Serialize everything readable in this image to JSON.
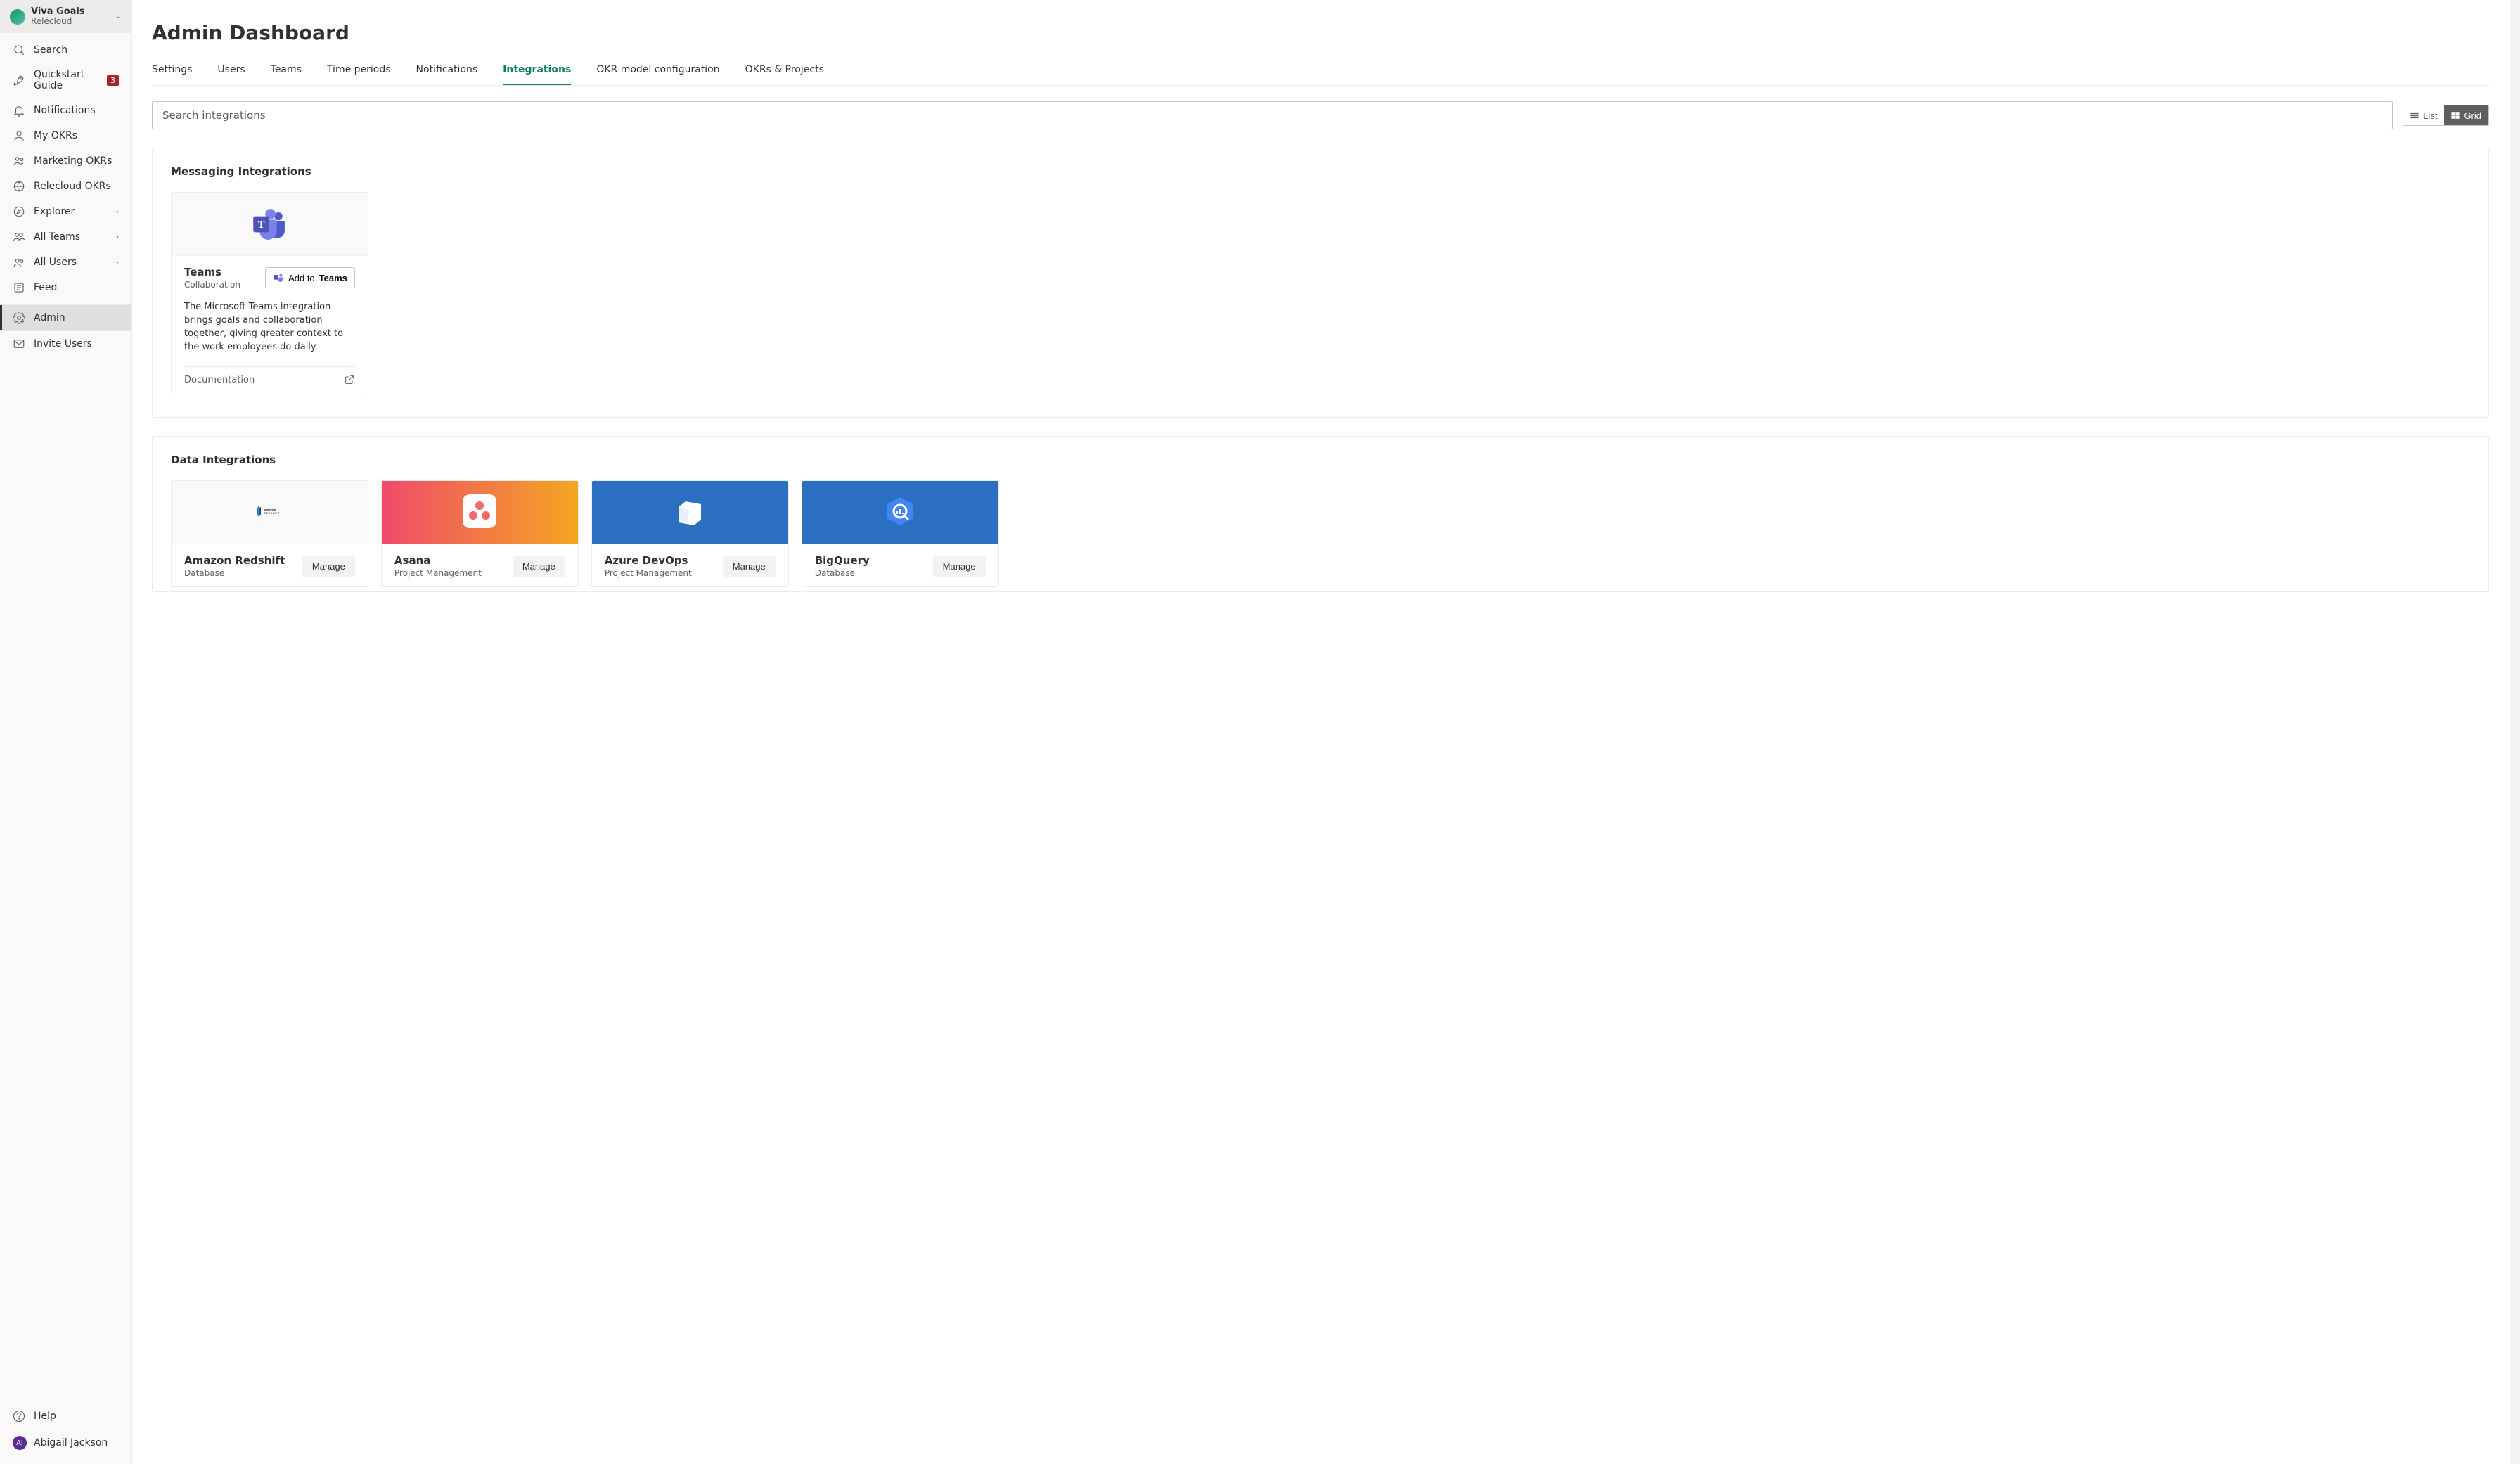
{
  "org": {
    "name": "Viva Goals",
    "sub": "Relecloud"
  },
  "sidebar": {
    "items": [
      {
        "label": "Search",
        "icon": "search",
        "badge": null,
        "expand": false
      },
      {
        "label": "Quickstart Guide",
        "icon": "rocket",
        "badge": "3",
        "expand": false
      },
      {
        "label": "Notifications",
        "icon": "bell",
        "badge": null,
        "expand": false
      },
      {
        "label": "My OKRs",
        "icon": "person",
        "badge": null,
        "expand": false
      },
      {
        "label": "Marketing OKRs",
        "icon": "team",
        "badge": null,
        "expand": false
      },
      {
        "label": "Relecloud OKRs",
        "icon": "globe",
        "badge": null,
        "expand": false
      },
      {
        "label": "Explorer",
        "icon": "compass",
        "badge": null,
        "expand": true
      },
      {
        "label": "All Teams",
        "icon": "teams",
        "badge": null,
        "expand": true
      },
      {
        "label": "All Users",
        "icon": "users",
        "badge": null,
        "expand": true
      },
      {
        "label": "Feed",
        "icon": "feed",
        "badge": null,
        "expand": false
      }
    ],
    "admin_label": "Admin",
    "invite_label": "Invite Users",
    "help_label": "Help",
    "user_name": "Abigail Jackson",
    "user_initials": "AJ"
  },
  "page": {
    "title": "Admin Dashboard"
  },
  "tabs": [
    {
      "label": "Settings"
    },
    {
      "label": "Users"
    },
    {
      "label": "Teams"
    },
    {
      "label": "Time periods"
    },
    {
      "label": "Notifications"
    },
    {
      "label": "Integrations",
      "active": true
    },
    {
      "label": "OKR model configuration"
    },
    {
      "label": "OKRs & Projects"
    }
  ],
  "search": {
    "placeholder": "Search integrations"
  },
  "view": {
    "list_label": "List",
    "grid_label": "Grid"
  },
  "sections": {
    "messaging": {
      "title": "Messaging Integrations",
      "teams_card": {
        "title": "Teams",
        "sub": "Collaboration",
        "add_prefix": "Add to",
        "add_bold": "Teams",
        "desc": "The Microsoft Teams integration brings goals and collaboration together, giving greater context to the work employees do daily.",
        "doc_label": "Documentation"
      }
    },
    "data": {
      "title": "Data Integrations",
      "cards": [
        {
          "title": "Amazon Redshift",
          "sub": "Database",
          "btn": "Manage",
          "banner": "light",
          "logo": "redshift"
        },
        {
          "title": "Asana",
          "sub": "Project Management",
          "btn": "Manage",
          "banner": "gradient",
          "logo": "asana"
        },
        {
          "title": "Azure DevOps",
          "sub": "Project Management",
          "btn": "Manage",
          "banner": "blue",
          "logo": "devops"
        },
        {
          "title": "BigQuery",
          "sub": "Database",
          "btn": "Manage",
          "banner": "blue2",
          "logo": "bigquery"
        }
      ]
    }
  }
}
